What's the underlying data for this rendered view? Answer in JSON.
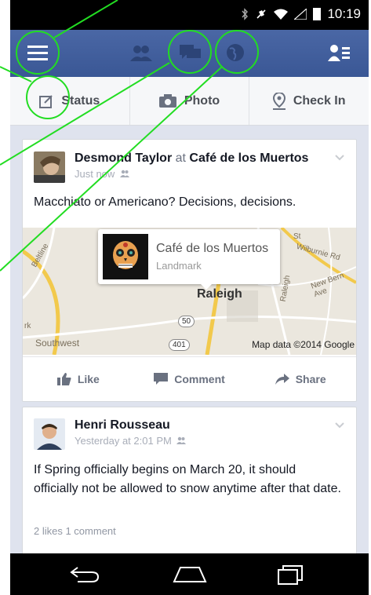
{
  "status": {
    "time": "10:19"
  },
  "actions": [
    {
      "label": "Status",
      "icon": "status-icon"
    },
    {
      "label": "Photo",
      "icon": "camera-icon"
    },
    {
      "label": "Check In",
      "icon": "checkin-icon"
    }
  ],
  "posts": [
    {
      "author": "Desmond Taylor",
      "at_text": "at",
      "place": "Café de los Muertos",
      "time": "Just now",
      "text": "Macchiato or Americano? Decisions, decisions.",
      "map": {
        "place_name": "Café de los Muertos",
        "place_type": "Landmark",
        "city": "Raleigh",
        "credit": "Map data ©2014 Google",
        "labels": {
          "st": "St",
          "wilburnie": "Wilburnie Rd",
          "newbern": "New Bern Ave",
          "beltline": "Beltline",
          "hwy50": "50",
          "hwy401": "401",
          "southwest": "Southwest",
          "rk": "rk",
          "raleigh_road": "Raleigh"
        }
      },
      "actions": [
        "Like",
        "Comment",
        "Share"
      ]
    },
    {
      "author": "Henri Rousseau",
      "time": "Yesterday at 2:01 PM",
      "text": "If Spring officially begins on March 20, it should officially not be allowed to snow anytime after that date.",
      "stats": "2 likes  1 comment"
    }
  ],
  "colors": {
    "header_blue": "#3b5998",
    "annotation_green": "#22dd22"
  }
}
